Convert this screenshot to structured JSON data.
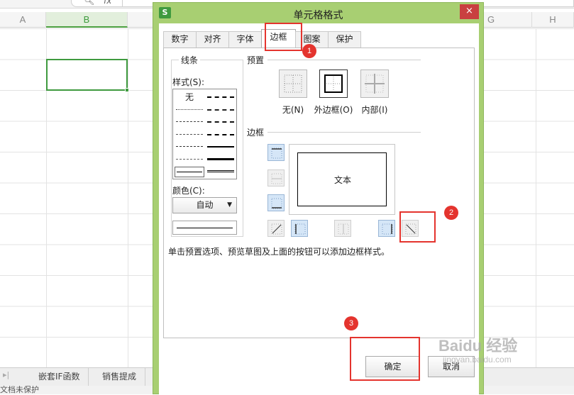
{
  "spreadsheet": {
    "fx_label": "fx",
    "columns": [
      "A",
      "B",
      "G",
      "H"
    ],
    "selected_column": "B",
    "sheet_tabs": [
      "嵌套IF函数",
      "销售提成"
    ],
    "status_text": "文档未保护"
  },
  "dialog": {
    "title": "单元格格式",
    "close_label": "×",
    "tabs": [
      "数字",
      "对齐",
      "字体",
      "边框",
      "图案",
      "保护"
    ],
    "active_tab": "边框",
    "line_group": {
      "label": "线条",
      "style_label": "样式(S):",
      "style_none": "无",
      "color_label": "颜色(C):",
      "color_value": "自动"
    },
    "preset_group": {
      "label": "预置",
      "presets": [
        "无(N)",
        "外边框(O)",
        "内部(I)"
      ]
    },
    "border_group": {
      "label": "边框",
      "preview_text": "文本"
    },
    "hint": "单击预置选项、预览草图及上面的按钮可以添加边框样式。",
    "ok_label": "确定",
    "cancel_label": "取消"
  },
  "annotations": [
    "1",
    "2",
    "3"
  ],
  "watermark": {
    "main": "Baidu 经验",
    "sub": "jingyan.baidu.com"
  },
  "colors": {
    "dialog_frame": "#a8cf72",
    "wps_green": "#3f9a3f",
    "annotation_red": "#e4342e",
    "close_red": "#c94040",
    "border_button_blue": "#d5e6f7"
  }
}
